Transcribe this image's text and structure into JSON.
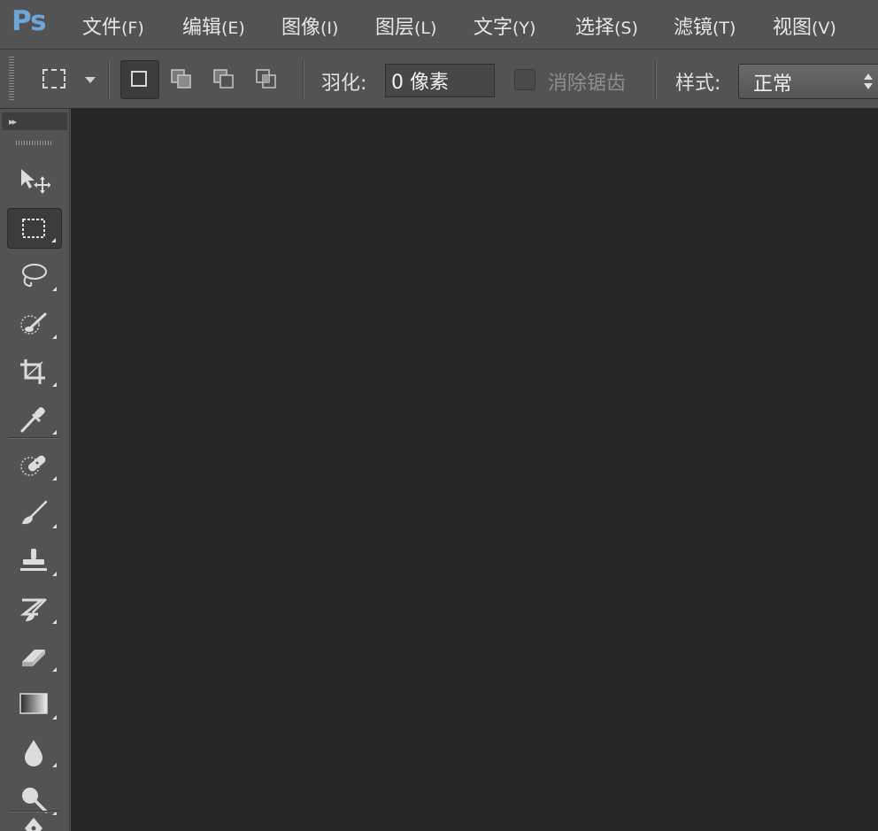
{
  "app": {
    "logo": "Ps"
  },
  "menu": [
    {
      "label": "文件",
      "accel": "(F)"
    },
    {
      "label": "编辑",
      "accel": "(E)"
    },
    {
      "label": "图像",
      "accel": "(I)"
    },
    {
      "label": "图层",
      "accel": "(L)"
    },
    {
      "label": "文字",
      "accel": "(Y)"
    },
    {
      "label": "选择",
      "accel": "(S)"
    },
    {
      "label": "滤镜",
      "accel": "(T)"
    },
    {
      "label": "视图",
      "accel": "(V)"
    }
  ],
  "options": {
    "tool_preset_icon": "rect-marquee-icon",
    "selection_modes": [
      "new-selection-icon",
      "add-to-selection-icon",
      "subtract-from-selection-icon",
      "intersect-selection-icon"
    ],
    "active_mode": "new-selection-icon",
    "feather_label": "羽化:",
    "feather_value": "0 像素",
    "antialias_label": "消除锯齿",
    "antialias_checked": false,
    "style_label": "样式:",
    "style_value": "正常"
  },
  "toolbar": {
    "tools": [
      "move-tool-icon",
      "rect-marquee-tool-icon",
      "lasso-tool-icon",
      "quick-selection-tool-icon",
      "crop-tool-icon",
      "eyedropper-tool-icon",
      "spot-healing-tool-icon",
      "brush-tool-icon",
      "clone-stamp-tool-icon",
      "history-brush-tool-icon",
      "eraser-tool-icon",
      "gradient-tool-icon",
      "blur-tool-icon",
      "dodge-tool-icon",
      "pen-tool-icon"
    ],
    "active_tool": "rect-marquee-tool-icon"
  },
  "colors": {
    "chrome": "#535353",
    "canvas": "#262626",
    "logo": "#6ea5da"
  }
}
